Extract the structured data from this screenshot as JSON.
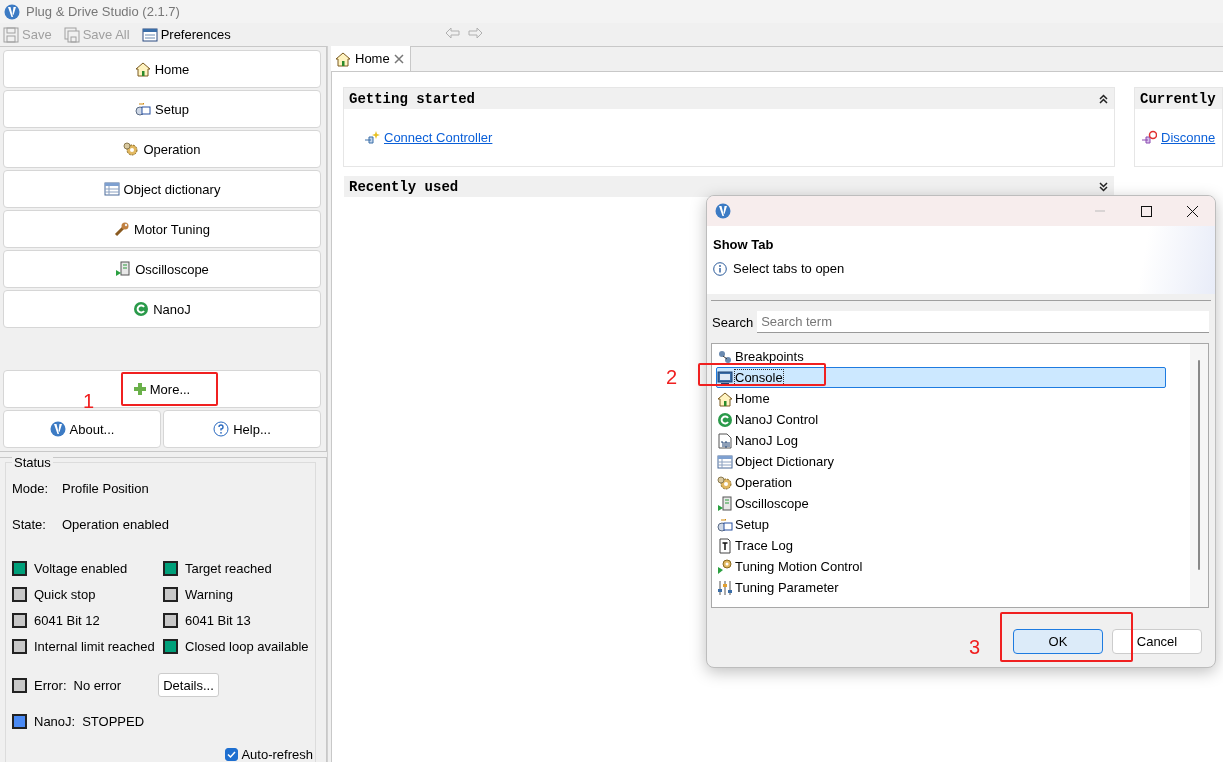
{
  "window": {
    "title": "Plug & Drive Studio (2.1.7)"
  },
  "toolbar": [
    {
      "label": "Save",
      "kind": "save",
      "disabled": true
    },
    {
      "label": "Save All",
      "kind": "saveall",
      "disabled": true
    },
    {
      "label": "Preferences",
      "kind": "prefs",
      "disabled": false
    }
  ],
  "nav": [
    {
      "label": "Home",
      "kind": "home"
    },
    {
      "label": "Setup",
      "kind": "setup"
    },
    {
      "label": "Operation",
      "kind": "gear"
    },
    {
      "label": "Object dictionary",
      "kind": "table"
    },
    {
      "label": "Motor Tuning",
      "kind": "wrench"
    },
    {
      "label": "Oscilloscope",
      "kind": "scope"
    },
    {
      "label": "NanoJ",
      "kind": "nanoj"
    }
  ],
  "more_button": "More...",
  "about_button": "About...",
  "help_button": "Help...",
  "status": {
    "title": "Status",
    "mode_label": "Mode:",
    "mode": "Profile Position",
    "state_label": "State:",
    "state": "Operation enabled",
    "indicators": [
      {
        "label": "Voltage enabled",
        "color": "#00a07a"
      },
      {
        "label": "Target reached",
        "color": "#00a07a"
      },
      {
        "label": "Quick stop",
        "color": "#c8c8c8"
      },
      {
        "label": "Warning",
        "color": "#c8c8c8"
      },
      {
        "label": "6041 Bit 12",
        "color": "#c8c8c8"
      },
      {
        "label": "6041 Bit 13",
        "color": "#c8c8c8"
      },
      {
        "label": "Internal limit reached",
        "color": "#c8c8c8"
      },
      {
        "label": "Closed loop available",
        "color": "#00a07a"
      }
    ],
    "error": {
      "label": "Error:",
      "value": "No error",
      "color": "#c8c8c8"
    },
    "details_button": "Details...",
    "nanoj": {
      "label": "NanoJ:",
      "value": "STOPPED",
      "color": "#4a8af4"
    },
    "auto_refresh": {
      "label": "Auto-refresh",
      "checked": true
    }
  },
  "editor_tabs": [
    {
      "label": "Home",
      "selected": true
    }
  ],
  "sections": [
    {
      "title": "Getting started",
      "expanded": true,
      "links": [
        "Connect Controller"
      ]
    },
    {
      "title": "Recently used",
      "expanded": false
    }
  ],
  "side_section": {
    "title": "Currently",
    "links": [
      "Disconne"
    ]
  },
  "dialog": {
    "title": "Show Tab",
    "message": "Select tabs to open",
    "search_label": "Search",
    "search_placeholder": "Search term",
    "items": [
      {
        "label": "Breakpoints",
        "kind": "breakpoints",
        "selected": false
      },
      {
        "label": "Console",
        "kind": "console",
        "selected": true
      },
      {
        "label": "Home",
        "kind": "home",
        "selected": false
      },
      {
        "label": "NanoJ Control",
        "kind": "nanoj",
        "selected": false
      },
      {
        "label": "NanoJ Log",
        "kind": "log",
        "selected": false
      },
      {
        "label": "Object Dictionary",
        "kind": "table",
        "selected": false
      },
      {
        "label": "Operation",
        "kind": "gear",
        "selected": false
      },
      {
        "label": "Oscilloscope",
        "kind": "scope",
        "selected": false
      },
      {
        "label": "Setup",
        "kind": "setup",
        "selected": false
      },
      {
        "label": "Trace Log",
        "kind": "trace",
        "selected": false
      },
      {
        "label": "Tuning Motion Control",
        "kind": "tuning",
        "selected": false
      },
      {
        "label": "Tuning Parameter",
        "kind": "sliders",
        "selected": false
      }
    ],
    "buttons": [
      {
        "label": "OK",
        "default": true
      },
      {
        "label": "Cancel",
        "default": false
      }
    ]
  },
  "annotations": [
    {
      "label": "1"
    },
    {
      "label": "2"
    },
    {
      "label": "3"
    }
  ]
}
